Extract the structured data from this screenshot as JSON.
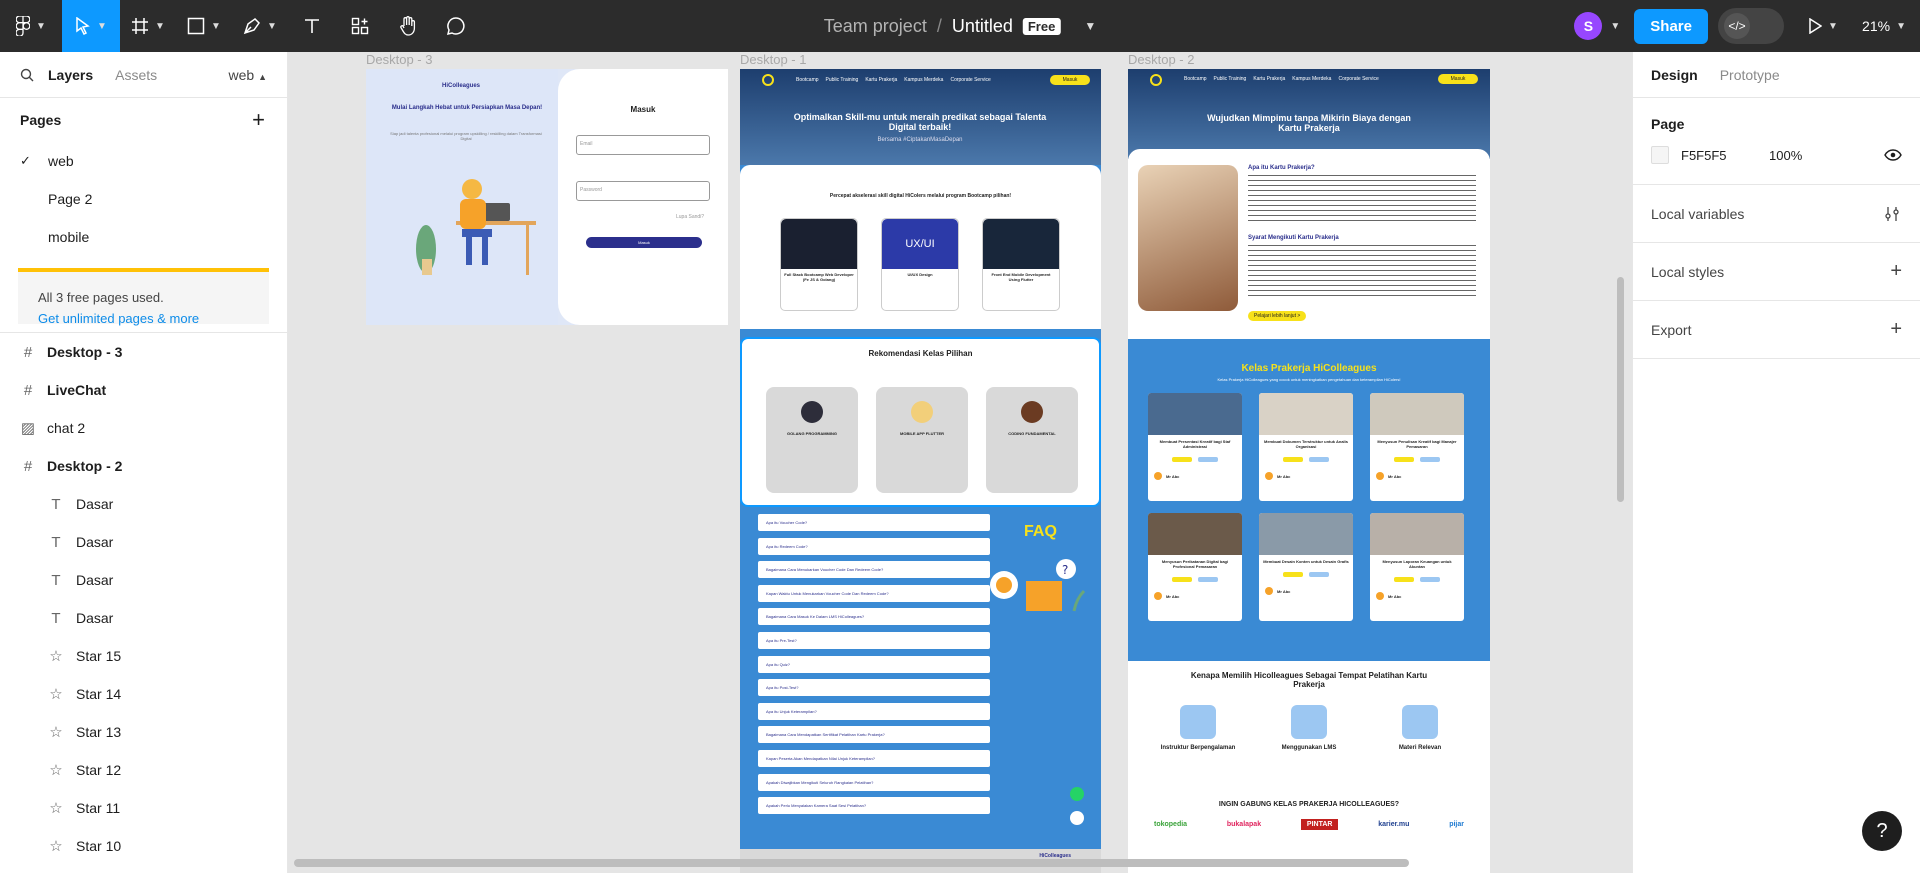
{
  "toolbar": {
    "project": "Team project",
    "separator": "/",
    "file_name": "Untitled",
    "plan_badge": "Free",
    "user_initial": "S",
    "share_label": "Share",
    "zoom": "21%"
  },
  "left_panel": {
    "tabs": {
      "layers": "Layers",
      "assets": "Assets",
      "current_page": "web"
    },
    "pages_title": "Pages",
    "pages": [
      {
        "label": "web",
        "selected": true
      },
      {
        "label": "Page 2",
        "selected": false
      },
      {
        "label": "mobile",
        "selected": false
      }
    ],
    "banner": {
      "text": "All 3 free pages used.",
      "link": "Get unlimited pages & more"
    },
    "layers": [
      {
        "name": "Desktop - 3",
        "icon": "frame-icon",
        "level": 0
      },
      {
        "name": "LiveChat",
        "icon": "frame-icon",
        "level": 0
      },
      {
        "name": "chat 2",
        "icon": "image-icon",
        "level": 0
      },
      {
        "name": "Desktop - 2",
        "icon": "frame-icon",
        "level": 0
      },
      {
        "name": "Dasar",
        "icon": "text-icon",
        "level": 1
      },
      {
        "name": "Dasar",
        "icon": "text-icon",
        "level": 1
      },
      {
        "name": "Dasar",
        "icon": "text-icon",
        "level": 1
      },
      {
        "name": "Dasar",
        "icon": "text-icon",
        "level": 1
      },
      {
        "name": "Star 15",
        "icon": "star-icon",
        "level": 1
      },
      {
        "name": "Star 14",
        "icon": "star-icon",
        "level": 1
      },
      {
        "name": "Star 13",
        "icon": "star-icon",
        "level": 1
      },
      {
        "name": "Star 12",
        "icon": "star-icon",
        "level": 1
      },
      {
        "name": "Star 11",
        "icon": "star-icon",
        "level": 1
      },
      {
        "name": "Star 10",
        "icon": "star-icon",
        "level": 1
      }
    ]
  },
  "canvas": {
    "frames": {
      "desktop3": {
        "label": "Desktop - 3",
        "brand": "HiColleagues",
        "headline": "Mulai Langkah Hebat untuk Persiapkan Masa Depan!",
        "sub": "Siap jadi talenta profesional melalui program upskilling / reskilling dalam Transformasi Digital",
        "login_title": "Masuk",
        "email_placeholder": "Email",
        "password_placeholder": "Password",
        "forgot": "Lupa Sandi?",
        "login_button": "Masuk"
      },
      "desktop1": {
        "label": "Desktop - 1",
        "nav": [
          "Bootcamp",
          "Public Training",
          "Kartu Prakerja",
          "Kampus Merdeka",
          "Corporate Service"
        ],
        "nav_button": "Masuk",
        "hero_title": "Optimalkan Skill-mu untuk meraih predikat sebagai Talenta Digital terbaik!",
        "hero_sub": "Bersama #CiptakanMasaDepan",
        "bootcamp_title": "Percepat akselerasi skill digital HiColers melalui program Bootcamp pilihan!",
        "bootcamp_cards": [
          "Full Stack Bootcamp Web Developer (Fe JS & Golang)",
          "UI/UX Design",
          "Front End Mobile Development Using Flutter"
        ],
        "ux_card_label": "UX/UI",
        "rec_title": "Rekomendasi Kelas Pilihan",
        "rec_cards": [
          "GOLANG PROGRAMMING",
          "MOBILE APP FLUTTER",
          "CODING FUNDAMENTAL"
        ],
        "faq_title": "FAQ",
        "faq_items": [
          "Apa itu Voucher Code?",
          "Apa itu Redeem Code?",
          "Bagaimana Cara Menukarkan Voucher Code Dan Redeem Code?",
          "Kapan Waktu Untuk Menukarkan Voucher Code Dan Redeem Code?",
          "Bagaimana Cara Masuk Ke Dalam LMS HiColleagues?",
          "Apa itu Pre-Test?",
          "Apa itu Quiz?",
          "Apa itu Post-Test?",
          "Apa itu Unjuk Keterampilan?",
          "Bagaimana Cara Mendapatkan Sertifikat Pelatihan Kartu Prakerja?",
          "Kapan Peserta Akan Mendapatkan Nilai Unjuk Keterampilan?",
          "Apakah Diwajibkan Mengikuti Seluruh Rangkaian Pelatihan?",
          "Apakah Perlu Menyalakan Kamera Saat Sesi Pelatihan?"
        ],
        "footer_brand": "HiColleagues"
      },
      "desktop2": {
        "label": "Desktop - 2",
        "nav": [
          "Bootcamp",
          "Public Training",
          "Kartu Prakerja",
          "Kampus Merdeka",
          "Corporate Service"
        ],
        "nav_button": "Masuk",
        "hero_title": "Wujudkan Mimpimu tanpa Mikirin Biaya dengan Kartu Prakerja",
        "about_title": "Apa itu Kartu Prakerja?",
        "about_sub": "Syarat Mengikuti Kartu Prakerja",
        "cta": "Pelajari lebih lanjut >",
        "kelas_title": "Kelas Prakerja HiColleagues",
        "kelas_sub": "Kelas Prakerja HiColleagues yang cocok untuk meningkatkan pengetahuan dan keterampilan HiColers!",
        "kelas_cards": [
          "Membuat Presentasi Kreatif bagi Staf Administrasi",
          "Membuat Dokumen Terstruktur untuk Analis Organisasi",
          "Menyusun Penulisan Kreatif bagi Manajer Pemasaran",
          "Menyusun Perikatanan Digital bagi Profesional Pemasaran",
          "Membuat Desain Konten untuk Desain Grafis",
          "Menyusun Laporan Keuangan untuk Akuntan"
        ],
        "mentor": "Mr Abc",
        "why_title": "Kenapa Memilih Hicolleagues Sebagai Tempat Pelatihan Kartu Prakerja",
        "why_items": [
          "Instruktur Berpengalaman",
          "Menggunakan LMS",
          "Materi Relevan"
        ],
        "join_title": "INGIN GABUNG KELAS PRAKERJA HICOLLEAGUES?",
        "partners": [
          "tokopedia",
          "bukalapak",
          "PINTAR",
          "karier.mu",
          "pijar"
        ]
      }
    }
  },
  "right_panel": {
    "tabs": {
      "design": "Design",
      "prototype": "Prototype"
    },
    "page_title": "Page",
    "page_color": "F5F5F5",
    "page_opacity": "100%",
    "local_variables": "Local variables",
    "local_styles": "Local styles",
    "export": "Export",
    "help": "?"
  },
  "colors": {
    "toolbar_bg": "#2c2c2c",
    "accent": "#0d99ff",
    "canvas_bg": "#e5e5e5",
    "site_blue": "#3a8ad4",
    "site_yellow": "#f7e11a",
    "site_navy": "#2b2f8c"
  }
}
